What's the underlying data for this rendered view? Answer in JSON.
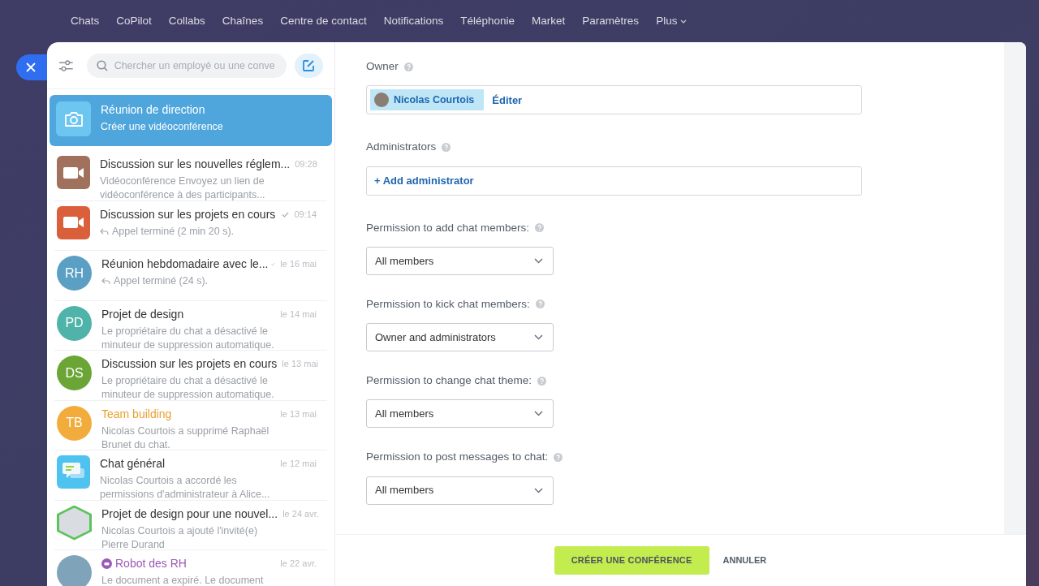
{
  "nav": [
    {
      "label": "Chats"
    },
    {
      "label": "CoPilot"
    },
    {
      "label": "Collabs"
    },
    {
      "label": "Chaînes"
    },
    {
      "label": "Centre de contact"
    },
    {
      "label": "Notifications"
    },
    {
      "label": "Téléphonie"
    },
    {
      "label": "Market"
    },
    {
      "label": "Paramètres"
    },
    {
      "label": "Plus",
      "dropdown": true
    }
  ],
  "search": {
    "placeholder": "Chercher un employé ou une conve"
  },
  "chats": [
    {
      "title": "Réunion de direction",
      "preview": "Créer une vidéoconférence",
      "avatar": {
        "kind": "camera",
        "color": "#6cc6f0"
      },
      "selected": true
    },
    {
      "title": "Discussion sur les nouvelles réglem...",
      "preview": "Vidéoconférence Envoyez un lien de vidéoconférence à des participants...",
      "time": "09:28",
      "avatar": {
        "kind": "video",
        "color": "#a0725d"
      },
      "selected": false
    },
    {
      "title": "Discussion sur les projets en cours",
      "preview": "Appel terminé (2 min 20 s).",
      "time": "09:14",
      "read": true,
      "reply": true,
      "avatar": {
        "kind": "video",
        "color": "#d9603b"
      },
      "selected": false
    },
    {
      "title": "Réunion hebdomadaire avec le...",
      "preview": "Appel terminé (24 s).",
      "time": "le 16 mai",
      "read": true,
      "reply": true,
      "avatar": {
        "kind": "initials",
        "initials": "RH",
        "color": "#5b9fc4"
      },
      "selected": false
    },
    {
      "title": "Projet de design",
      "preview": "Le propriétaire du chat a désactivé le minuteur de suppression automatique.",
      "time": "le 14 mai",
      "avatar": {
        "kind": "initials",
        "initials": "PD",
        "color": "#4fb3a9"
      },
      "selected": false
    },
    {
      "title": "Discussion sur les projets en cours",
      "preview": "Le propriétaire du chat a désactivé le minuteur de suppression automatique.",
      "time": "le 13 mai",
      "avatar": {
        "kind": "initials",
        "initials": "DS",
        "color": "#6aa535"
      },
      "selected": false
    },
    {
      "title": "Team building",
      "color": "#e8a030",
      "preview": "Nicolas Courtois a supprimé Raphaël Brunet du chat.",
      "time": "le 13 mai",
      "avatar": {
        "kind": "initials",
        "initials": "TB",
        "color": "#f2ac3c"
      },
      "selected": false
    },
    {
      "title": "Chat général",
      "preview": "Nicolas Courtois a accordé les permissions d'administrateur à Alice...",
      "time": "le 12 mai",
      "avatar": {
        "kind": "chat",
        "color": "#4fc3f0"
      },
      "selected": false
    },
    {
      "title": "Projet de design pour une nouvel...",
      "preview": "Nicolas Courtois a ajouté l'invité(e) Pierre Durand",
      "time": "le 24 avr.",
      "avatar": {
        "kind": "hexphoto",
        "color": "#5cc35c"
      },
      "selected": false
    },
    {
      "title": "Robot des RH",
      "color": "#9b59b6",
      "bot": true,
      "preview": "Le document a expiré. Le document",
      "time": "le 22 avr.",
      "avatar": {
        "kind": "photo",
        "color": "#7fa3b8"
      },
      "selected": false
    }
  ],
  "form": [
    {
      "kind": "owner",
      "label": "Owner",
      "user": "Nicolas Courtois",
      "action": "Éditer"
    },
    {
      "kind": "admins",
      "label": "Administrators",
      "action": "+ Add administrator"
    },
    {
      "kind": "select",
      "label": "Permission to add chat members:",
      "value": "All members"
    },
    {
      "kind": "select",
      "label": "Permission to kick chat members:",
      "value": "Owner and administrators"
    },
    {
      "kind": "select",
      "label": "Permission to change chat theme:",
      "value": "All members"
    },
    {
      "kind": "select",
      "label": "Permission to post messages to chat:",
      "value": "All members"
    }
  ],
  "footer": {
    "primary": "CRÉER UNE CONFÉRENCE",
    "secondary": "ANNULER"
  }
}
